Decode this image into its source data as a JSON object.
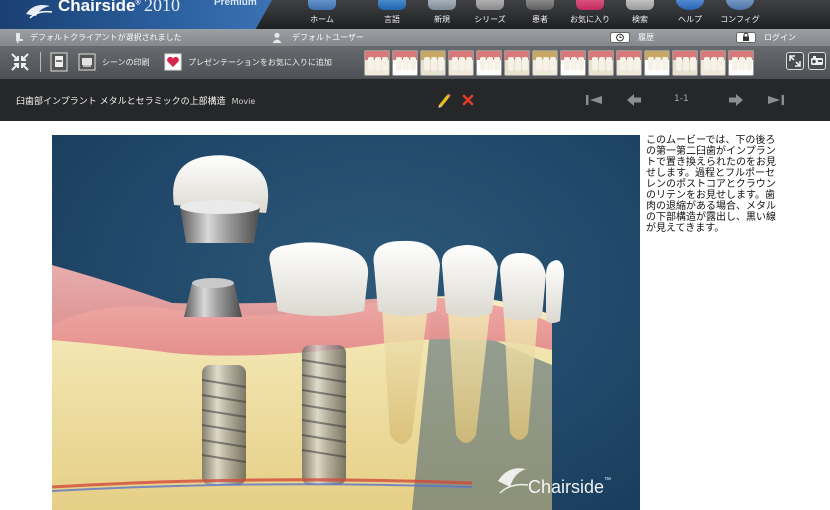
{
  "app": {
    "name": "Chairside",
    "name_mark": "®",
    "year": "2010",
    "edition": "Premium"
  },
  "nav": {
    "items": [
      {
        "label": "ホーム",
        "icon": "home-icon"
      },
      {
        "label": "言語",
        "icon": "globe-icon"
      },
      {
        "label": "新規",
        "icon": "new-presentation-icon"
      },
      {
        "label": "シリーズ",
        "icon": "film-reel-icon"
      },
      {
        "label": "患者",
        "icon": "patient-icon"
      },
      {
        "label": "お気に入り",
        "icon": "heart-icon"
      },
      {
        "label": "検索",
        "icon": "search-icon"
      },
      {
        "label": "ヘルプ",
        "icon": "help-icon"
      },
      {
        "label": "コンフィグ",
        "icon": "gear-icon"
      }
    ]
  },
  "status": {
    "client": "デフォルトクライアントが選択されました",
    "user": "デフォルトユーザー",
    "history": "履歴",
    "login": "ログイン"
  },
  "toolbar": {
    "print_scene": "シーンの印刷",
    "add_favorite": "プレゼンテーションをお気に入りに追加",
    "thumbnail_count": 14
  },
  "movie": {
    "title": "臼歯部インプラント メタルとセラミックの上部構造",
    "kind": "Movie",
    "page": "1-1",
    "description": "このムービーでは、下の後ろの第一第二臼歯がインプラントで置き換えられたのをお見せします。過程とフルポーセレンのポストコアとクラウンのリテンをお見せします。歯肉の退縮がある場合、メタルの下部構造が露出し、黒い線が見えてきます。"
  },
  "watermark": {
    "text": "Chairside",
    "tm": "™"
  },
  "colors": {
    "brand_blue": "#2a5f9e",
    "frame_blue": "#21486a",
    "gum_pink": "#e99a9a",
    "bone_yellow": "#f1e2a6",
    "edit_pencil": "#e6c11e",
    "delete_red": "#e23b2a"
  }
}
